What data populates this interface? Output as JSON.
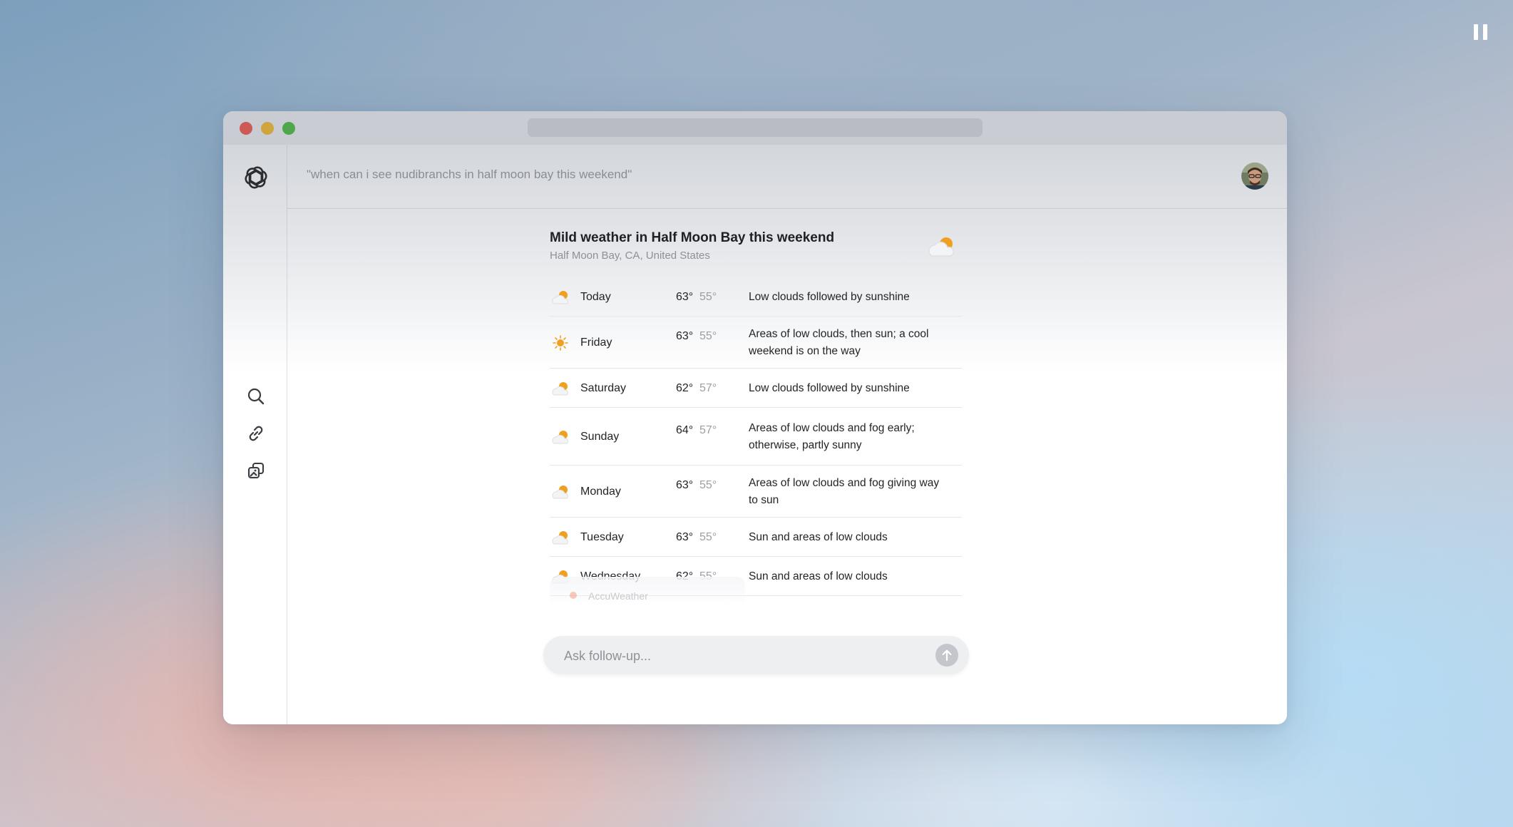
{
  "query": "\"when can i see nudibranchs in half moon bay this weekend\"",
  "weather": {
    "title": "Mild weather in Half Moon Bay this weekend",
    "location": "Half Moon Bay, CA, United States",
    "current_icon": "partly-sunny-icon",
    "days": [
      {
        "day": "Today",
        "hi": "63°",
        "lo": "55°",
        "desc": "Low clouds followed by sunshine",
        "icon": "partly-sunny-icon"
      },
      {
        "day": "Friday",
        "hi": "63°",
        "lo": "55°",
        "desc": "Areas of low clouds, then sun; a cool weekend is on the way",
        "icon": "sunny-icon"
      },
      {
        "day": "Saturday",
        "hi": "62°",
        "lo": "57°",
        "desc": "Low clouds followed by sunshine",
        "icon": "partly-sunny-icon"
      },
      {
        "day": "Sunday",
        "hi": "64°",
        "lo": "57°",
        "desc": "Areas of low clouds and fog early; otherwise, partly sunny",
        "icon": "partly-sunny-icon"
      },
      {
        "day": "Monday",
        "hi": "63°",
        "lo": "55°",
        "desc": "Areas of low clouds and fog giving way to sun",
        "icon": "partly-sunny-icon"
      },
      {
        "day": "Tuesday",
        "hi": "63°",
        "lo": "55°",
        "desc": "Sun and areas of low clouds",
        "icon": "partly-sunny-icon"
      },
      {
        "day": "Wednesday",
        "hi": "62°",
        "lo": "55°",
        "desc": "Sun and areas of low clouds",
        "icon": "partly-sunny-icon"
      }
    ],
    "source": "AccuWeather"
  },
  "followup": {
    "placeholder": "Ask follow-up..."
  },
  "sidebar": {
    "icons": [
      "search-icon",
      "link-icon",
      "gallery-icon"
    ]
  },
  "colors": {
    "accent_orange": "#f0a020",
    "close": "#cc5a55",
    "minimize": "#cfa53f",
    "maximize": "#4ea74a"
  }
}
